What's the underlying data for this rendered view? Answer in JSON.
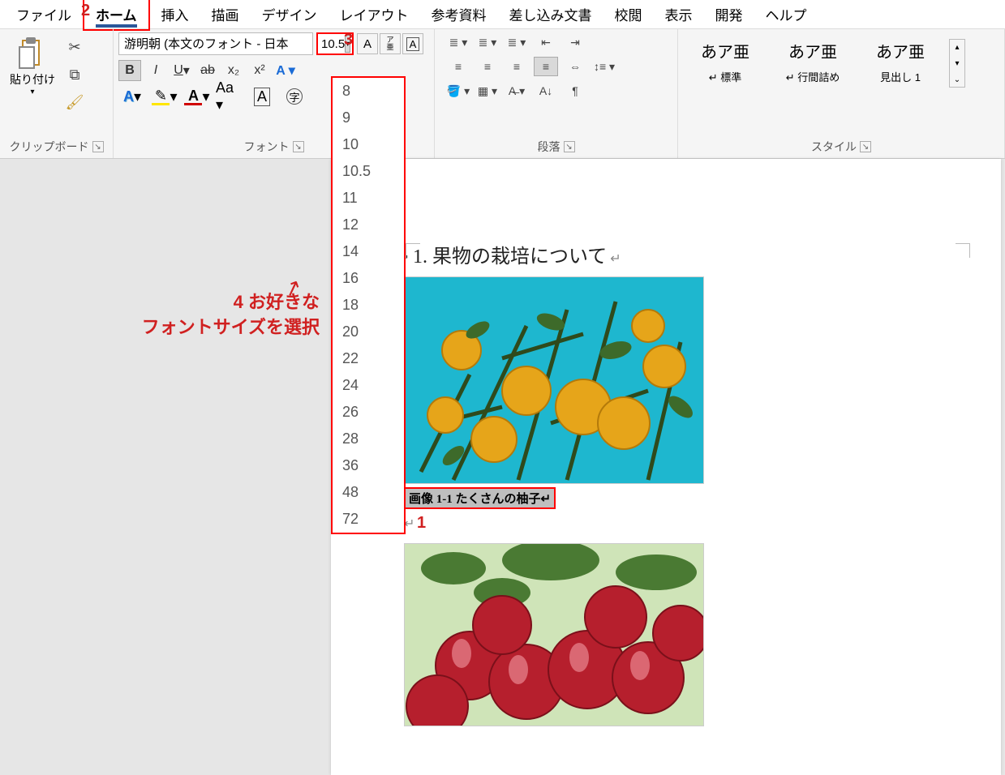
{
  "menu": {
    "items": [
      "ファイル",
      "ホーム",
      "挿入",
      "描画",
      "デザイン",
      "レイアウト",
      "参考資料",
      "差し込み文書",
      "校閲",
      "表示",
      "開発",
      "ヘルプ"
    ],
    "active": "ホーム"
  },
  "clipboard": {
    "paste_label": "貼り付け",
    "group_label": "クリップボード"
  },
  "font": {
    "name": "游明朝 (本文のフォント - 日本",
    "size": "10.5",
    "group_label": "フォント",
    "bold": "B",
    "italic": "I",
    "underline": "U",
    "strike": "ab",
    "sub": "x₂",
    "sup": "x²",
    "grow": "A",
    "shrink": "A",
    "phonetic": "ア亜",
    "charborder": "A",
    "clear": "Aa",
    "circled": "字"
  },
  "paragraph": {
    "group_label": "段落"
  },
  "styles": {
    "group_label": "スタイル",
    "sample": "あア亜",
    "items": [
      "標準",
      "行間詰め",
      "見出し 1"
    ]
  },
  "sizes": [
    "8",
    "9",
    "10",
    "10.5",
    "11",
    "12",
    "14",
    "16",
    "18",
    "20",
    "22",
    "24",
    "26",
    "28",
    "36",
    "48",
    "72"
  ],
  "annotations": {
    "n1": "1",
    "n2": "2",
    "n3": "3",
    "n4_line1": "4 お好きな",
    "n4_line2": "フォントサイズを選択"
  },
  "document": {
    "heading": "1. 果物の栽培について",
    "caption": "画像 1-1 たくさんの柚子"
  }
}
